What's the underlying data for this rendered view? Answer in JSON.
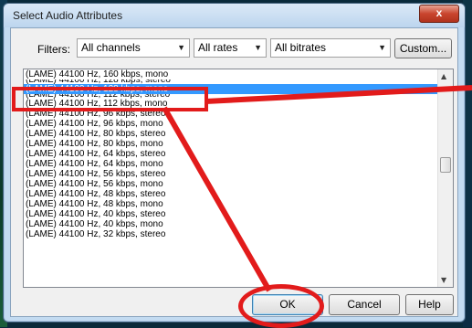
{
  "window": {
    "title": "Select Audio Attributes",
    "close_glyph": "x"
  },
  "filters": {
    "label": "Filters:",
    "channels": "All channels",
    "rates": "All rates",
    "bitrates": "All bitrates",
    "custom_label": "Custom..."
  },
  "list": {
    "items": [
      "(LAME) 44100 Hz, 160 kbps, mono",
      "(LAME) 44100 Hz, 128 kbps, stereo",
      "(LAME) 44100 Hz, 128 kbps, mono",
      "(LAME) 44100 Hz, 112 kbps, stereo",
      "(LAME) 44100 Hz, 112 kbps, mono",
      "(LAME) 44100 Hz, 96 kbps, stereo",
      "(LAME) 44100 Hz, 96 kbps, mono",
      "(LAME) 44100 Hz, 80 kbps, stereo",
      "(LAME) 44100 Hz, 80 kbps, mono",
      "(LAME) 44100 Hz, 64 kbps, stereo",
      "(LAME) 44100 Hz, 64 kbps, mono",
      "(LAME) 44100 Hz, 56 kbps, stereo",
      "(LAME) 44100 Hz, 56 kbps, mono",
      "(LAME) 44100 Hz, 48 kbps, stereo",
      "(LAME) 44100 Hz, 48 kbps, mono",
      "(LAME) 44100 Hz, 40 kbps, stereo",
      "(LAME) 44100 Hz, 40 kbps, mono",
      "(LAME) 44100 Hz, 32 kbps, stereo"
    ],
    "selected_index": 2
  },
  "buttons": {
    "ok": "OK",
    "cancel": "Cancel",
    "help": "Help"
  },
  "icons": [
    "close-icon",
    "chevron-down-icon",
    "scroll-up-arrow-icon",
    "scroll-down-arrow-icon"
  ],
  "colors": {
    "selection": "#3399ff",
    "annotation": "#e21b1b"
  }
}
